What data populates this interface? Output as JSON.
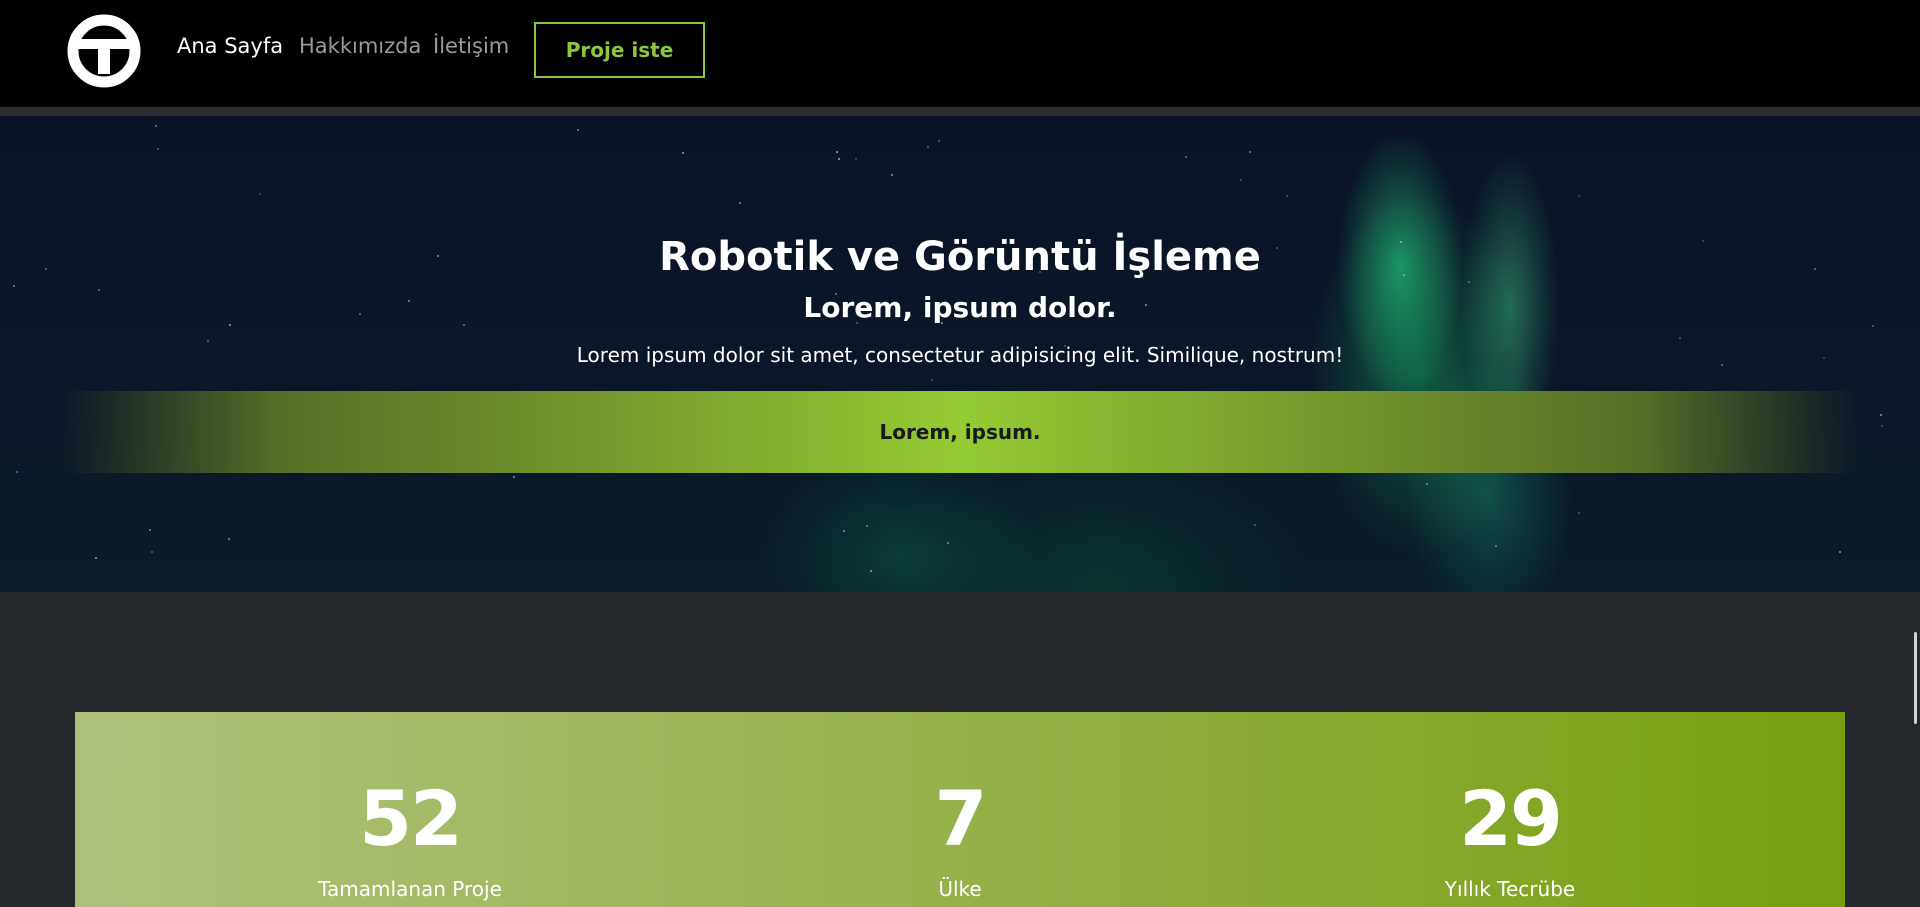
{
  "navbar": {
    "logo_icon": "t-circle-logo-icon",
    "links": [
      {
        "label": "Ana Sayfa",
        "active": true
      },
      {
        "label": "Hakkımızda",
        "active": false
      },
      {
        "label": "İletişim",
        "active": false
      }
    ],
    "cta_label": "Proje iste"
  },
  "hero": {
    "title": "Robotik ve Görüntü İşleme",
    "subtitle": "Lorem, ipsum dolor.",
    "text": "Lorem ipsum dolor sit amet, consectetur adipisicing elit. Similique, nostrum!",
    "band_label": "Lorem, ipsum."
  },
  "stats": [
    {
      "number": "52",
      "label": "Tamamlanan Proje"
    },
    {
      "number": "7",
      "label": "Ülke"
    },
    {
      "number": "29",
      "label": "Yıllık Tecrübe"
    }
  ],
  "colors": {
    "accent": "#8dc63f",
    "navbar_bg": "#000000",
    "page_bg": "#25282d",
    "stats_gradient_start": "#aec17b",
    "stats_gradient_end": "#77a00e"
  }
}
